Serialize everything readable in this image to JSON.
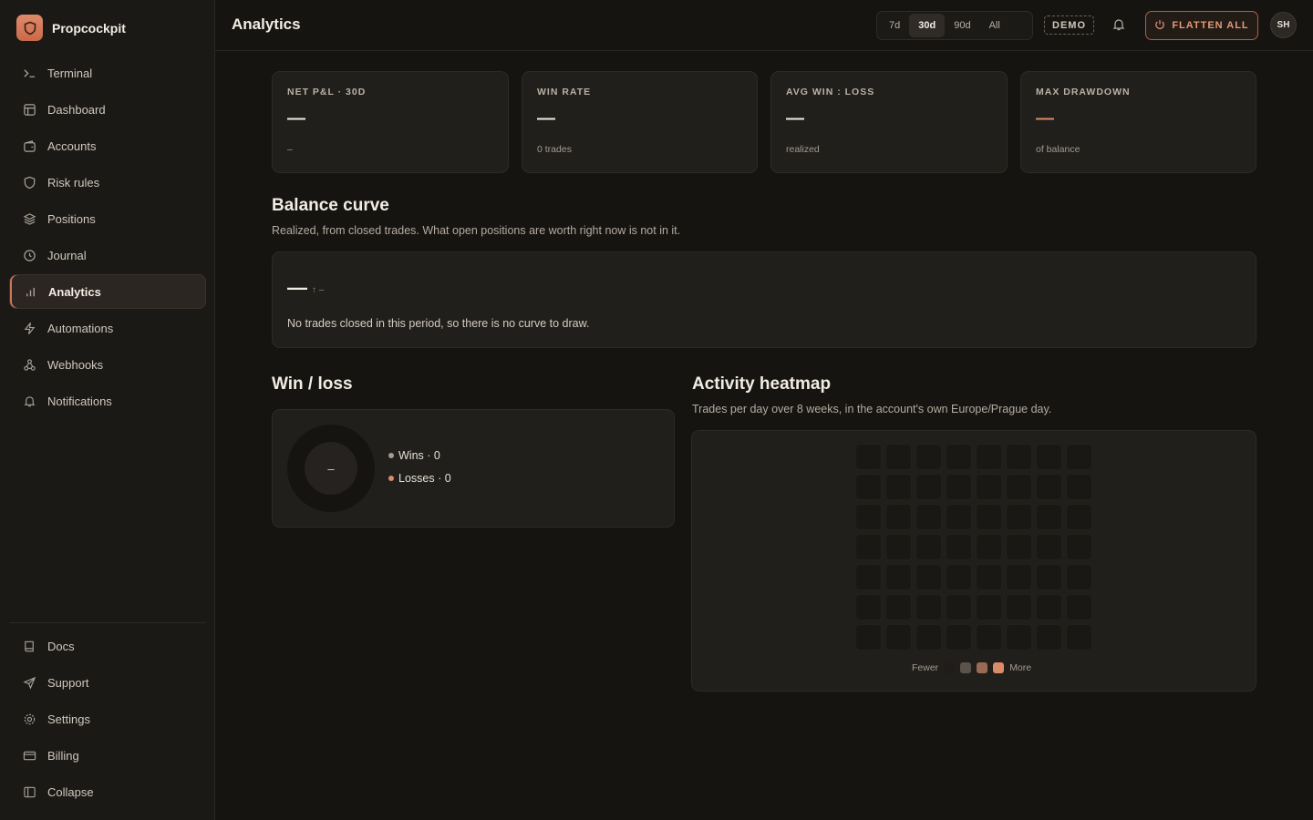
{
  "app": {
    "name": "Propcockpit"
  },
  "sidebar": {
    "items": [
      {
        "label": "Terminal",
        "icon": "terminal-icon"
      },
      {
        "label": "Dashboard",
        "icon": "layout-icon"
      },
      {
        "label": "Accounts",
        "icon": "wallet-icon"
      },
      {
        "label": "Risk rules",
        "icon": "shield-icon"
      },
      {
        "label": "Positions",
        "icon": "layers-icon"
      },
      {
        "label": "Journal",
        "icon": "history-icon"
      },
      {
        "label": "Analytics",
        "icon": "bar-chart-icon",
        "active": true
      },
      {
        "label": "Automations",
        "icon": "lightning-icon"
      },
      {
        "label": "Webhooks",
        "icon": "webhook-icon"
      },
      {
        "label": "Notifications",
        "icon": "bell-icon"
      }
    ],
    "bottom": [
      {
        "label": "Docs",
        "icon": "book-icon"
      },
      {
        "label": "Support",
        "icon": "send-icon"
      },
      {
        "label": "Settings",
        "icon": "gear-icon"
      },
      {
        "label": "Billing",
        "icon": "credit-card-icon"
      },
      {
        "label": "Collapse",
        "icon": "sidebar-collapse-icon"
      }
    ]
  },
  "header": {
    "title": "Analytics",
    "ranges": [
      "7d",
      "30d",
      "90d",
      "All"
    ],
    "active_range": "30d",
    "mode_badge": "DEMO",
    "flatten_label": "FLATTEN ALL",
    "avatar_initials": "SH"
  },
  "stats": [
    {
      "label": "NET P&L · 30D",
      "value": "—",
      "sub": "–"
    },
    {
      "label": "WIN RATE",
      "value": "—",
      "sub": "0 trades"
    },
    {
      "label": "AVG WIN : LOSS",
      "value": "—",
      "sub": "realized"
    },
    {
      "label": "MAX DRAWDOWN",
      "value": "—",
      "sub": "of balance"
    }
  ],
  "balance_curve": {
    "title": "Balance curve",
    "subtitle": "Realized, from closed trades. What open positions are worth right now is not in it.",
    "value": "—",
    "delta": "↑ –",
    "empty_message": "No trades closed in this period, so there is no curve to draw."
  },
  "win_loss": {
    "title": "Win / loss",
    "center": "–",
    "wins_label": "Wins · 0",
    "losses_label": "Losses · 0",
    "wins": 0,
    "losses": 0
  },
  "heatmap": {
    "title": "Activity heatmap",
    "subtitle": "Trades per day over 8 weeks, in the account's own Europe/Prague day.",
    "weeks": 8,
    "days": 7,
    "legend_low": "Fewer",
    "legend_high": "More"
  },
  "colors": {
    "accent": "#d98b6a",
    "wins": "#a39b90",
    "losses": "#d98b6a"
  }
}
